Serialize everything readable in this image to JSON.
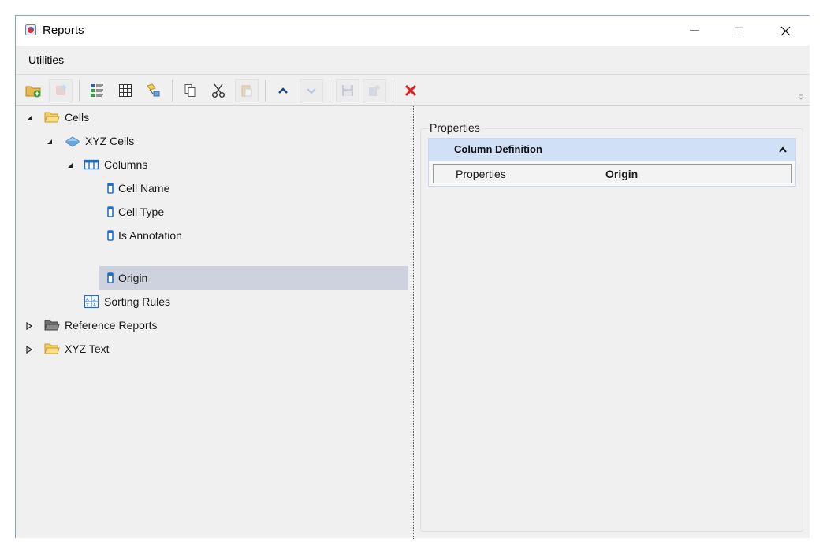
{
  "window": {
    "title": "Reports"
  },
  "menu": {
    "items": [
      "Utilities"
    ]
  },
  "toolbar": {
    "buttons": [
      {
        "icon": "new-folder-icon",
        "enabled": true
      },
      {
        "icon": "new-report-icon",
        "enabled": false
      },
      {
        "icon": "column-definition-icon",
        "enabled": true
      },
      {
        "icon": "table-icon",
        "enabled": true
      },
      {
        "icon": "sorting-icon",
        "enabled": true
      },
      {
        "icon": "copy-icon",
        "enabled": true
      },
      {
        "icon": "cut-icon",
        "enabled": true
      },
      {
        "icon": "paste-icon",
        "enabled": false
      },
      {
        "icon": "move-up-icon",
        "enabled": true
      },
      {
        "icon": "move-down-icon",
        "enabled": false
      },
      {
        "icon": "save-icon",
        "enabled": false
      },
      {
        "icon": "export-icon",
        "enabled": false
      },
      {
        "icon": "delete-icon",
        "enabled": true
      }
    ]
  },
  "tree": {
    "cells": "Cells",
    "xyz_cells": "XYZ Cells",
    "columns": "Columns",
    "cell_name": "Cell Name",
    "cell_type": "Cell Type",
    "is_annotation": "Is Annotation",
    "origin": "Origin",
    "sorting_rules": "Sorting Rules",
    "reference_reports": "Reference Reports",
    "xyz_text": "XYZ Text"
  },
  "properties": {
    "caption": "Properties",
    "group_title": "Column Definition",
    "row_name": "Properties",
    "row_value": "Origin"
  },
  "colors": {
    "accent": "#1f6fc5",
    "selection": "#cdd2de",
    "group_header": "#cfe0f7",
    "delete": "#e02020"
  }
}
